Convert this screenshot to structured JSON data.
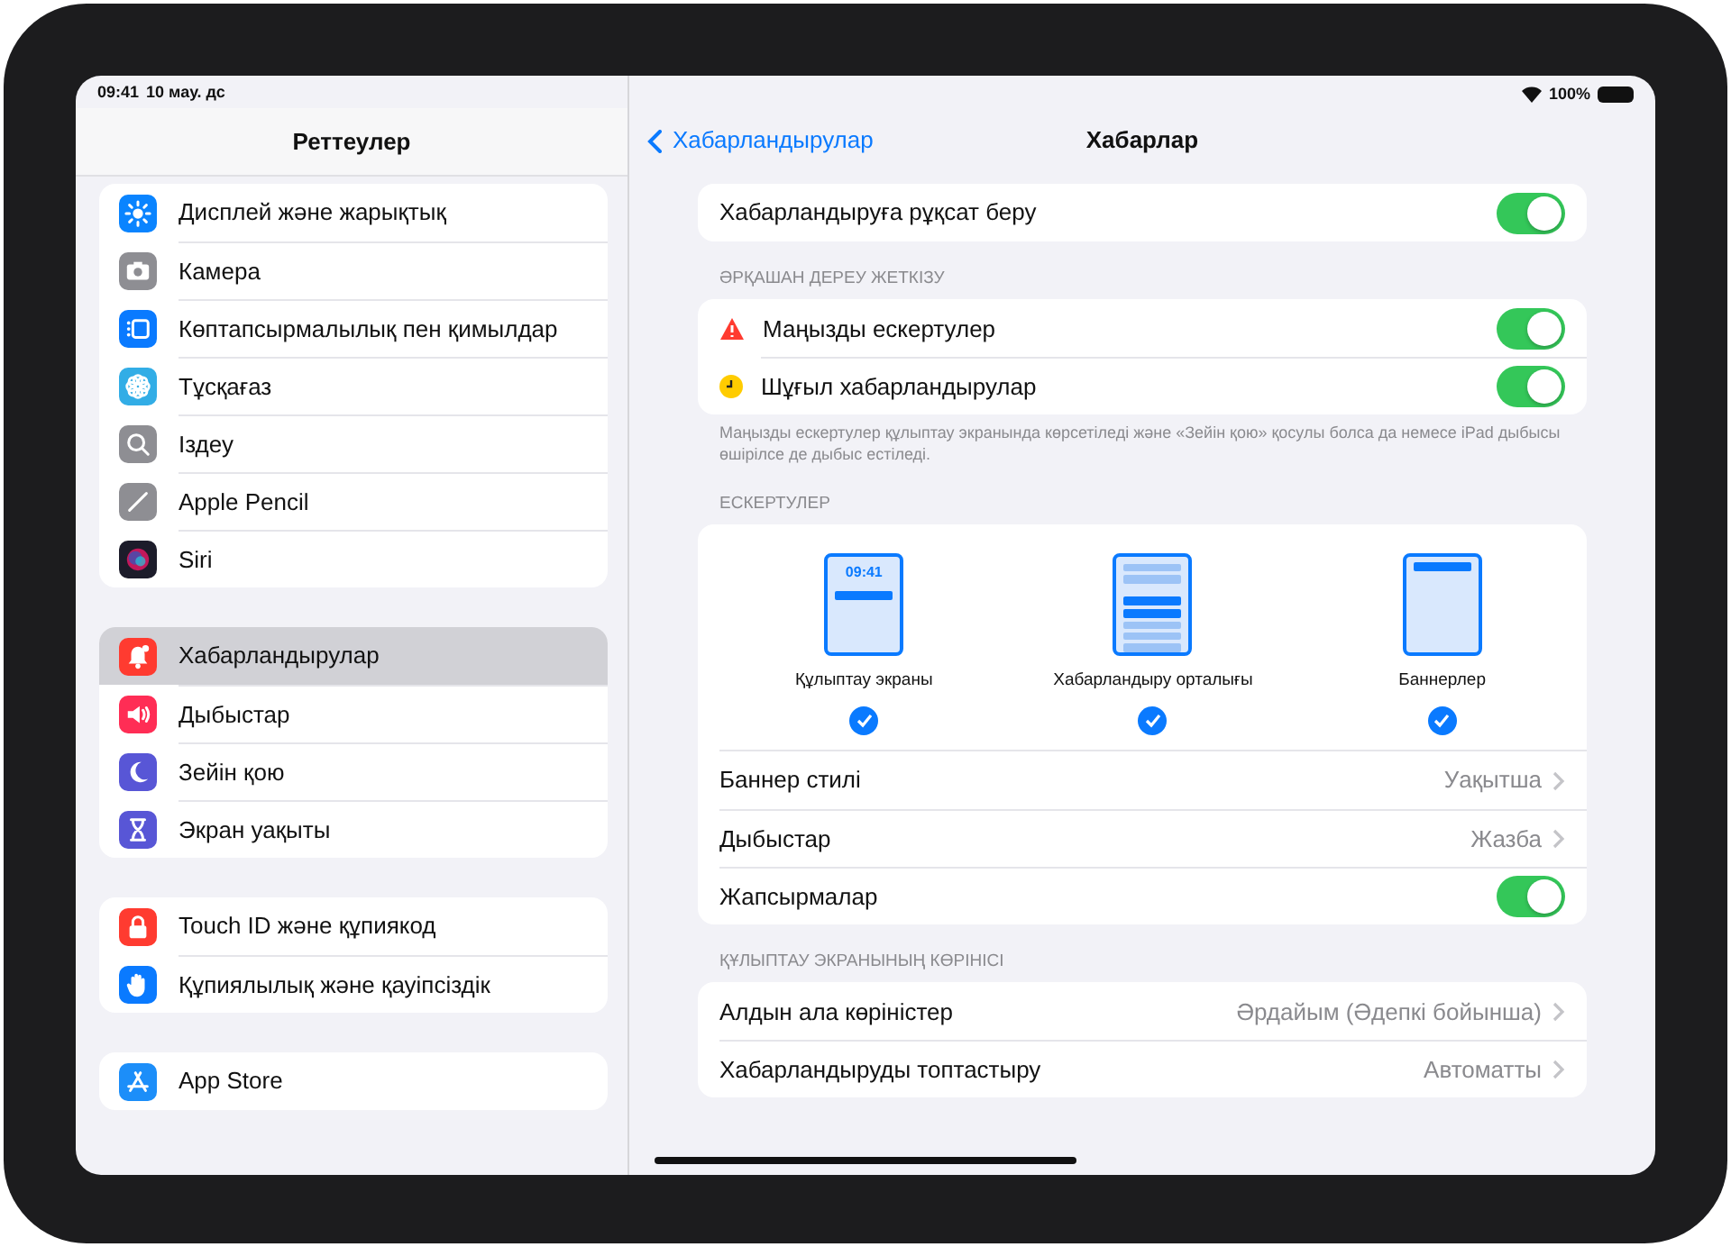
{
  "status_bar": {
    "time": "09:41",
    "date": "10 мау. дс",
    "battery": "100%"
  },
  "sidebar": {
    "title": "Реттеулер",
    "groups": [
      {
        "items": [
          {
            "label": "Дисплей және жарықтық",
            "kind": "display",
            "color": "#0a84ff",
            "selected": false
          },
          {
            "label": "Камера",
            "kind": "camera",
            "color": "#8e8e93",
            "selected": false
          },
          {
            "label": "Көптапсырмалылық пен қимылдар",
            "kind": "multitask",
            "color": "#0a7aff",
            "selected": false
          },
          {
            "label": "Тұсқағаз",
            "kind": "wallpaper",
            "color": "#32ade6",
            "selected": false
          },
          {
            "label": "Іздеу",
            "kind": "search",
            "color": "#8e8e93",
            "selected": false
          },
          {
            "label": "Apple Pencil",
            "kind": "pencil",
            "color": "#8e8e93",
            "selected": false
          },
          {
            "label": "Siri",
            "kind": "siri",
            "color": "#1c1c2a",
            "selected": false
          }
        ]
      },
      {
        "items": [
          {
            "label": "Хабарландырулар",
            "kind": "bell",
            "color": "#ff3b30",
            "selected": true
          },
          {
            "label": "Дыбыстар",
            "kind": "speaker",
            "color": "#ff2d55",
            "selected": false
          },
          {
            "label": "Зейін қою",
            "kind": "moon",
            "color": "#5856d6",
            "selected": false
          },
          {
            "label": "Экран уақыты",
            "kind": "hourglass",
            "color": "#5856d6",
            "selected": false
          }
        ]
      },
      {
        "items": [
          {
            "label": "Touch ID және құпиякод",
            "kind": "lock",
            "color": "#ff3b30",
            "selected": false
          },
          {
            "label": "Құпиялылық және қауіпсіздік",
            "kind": "hand",
            "color": "#0a7aff",
            "selected": false
          }
        ]
      },
      {
        "items": [
          {
            "label": "App Store",
            "kind": "appstore",
            "color": "#1c8ef9",
            "selected": false
          }
        ]
      }
    ]
  },
  "detail": {
    "back": "Хабарландырулар",
    "title": "Хабарлар",
    "sections": [
      {
        "rows": [
          {
            "kind": "toggle",
            "label": "Хабарландыруға рұқсат беру",
            "on": true
          }
        ]
      },
      {
        "header": "ӘРҚАШАН ДЕРЕУ ЖЕТКІЗУ",
        "rows": [
          {
            "kind": "critical",
            "label": "Маңызды ескертулер",
            "on": true
          },
          {
            "kind": "urgent",
            "label": "Шұғыл хабарландырулар",
            "on": true
          }
        ],
        "footer": "Маңызды ескертулер құлыптау экранында көрсетіледі және «Зейін қою» қосулы болса да немесе iPad дыбысы өшірілсе де дыбыс естіледі."
      },
      {
        "header": "ЕСКЕРТУЛЕР",
        "alert_styles": [
          {
            "kind": "lock",
            "label": "Құлыптау экраны",
            "preview_time": "09:41",
            "checked": true
          },
          {
            "kind": "center",
            "label": "Хабарландыру орталығы",
            "checked": true
          },
          {
            "kind": "banner",
            "label": "Баннерлер",
            "checked": true
          }
        ],
        "rows": [
          {
            "kind": "link",
            "label": "Баннер стилі",
            "value": "Уақытша"
          },
          {
            "kind": "link",
            "label": "Дыбыстар",
            "value": "Жазба"
          },
          {
            "kind": "toggle",
            "label": "Жапсырмалар",
            "on": true
          }
        ]
      },
      {
        "header": "ҚҰЛЫПТАУ ЭКРАНЫНЫҢ КӨРІНІСІ",
        "rows": [
          {
            "kind": "link",
            "label": "Алдын ала көріністер",
            "value": "Әрдайым (Әдепкі бойынша)"
          },
          {
            "kind": "link",
            "label": "Хабарландыруды топтастыру",
            "value": "Автоматты"
          }
        ]
      }
    ]
  }
}
